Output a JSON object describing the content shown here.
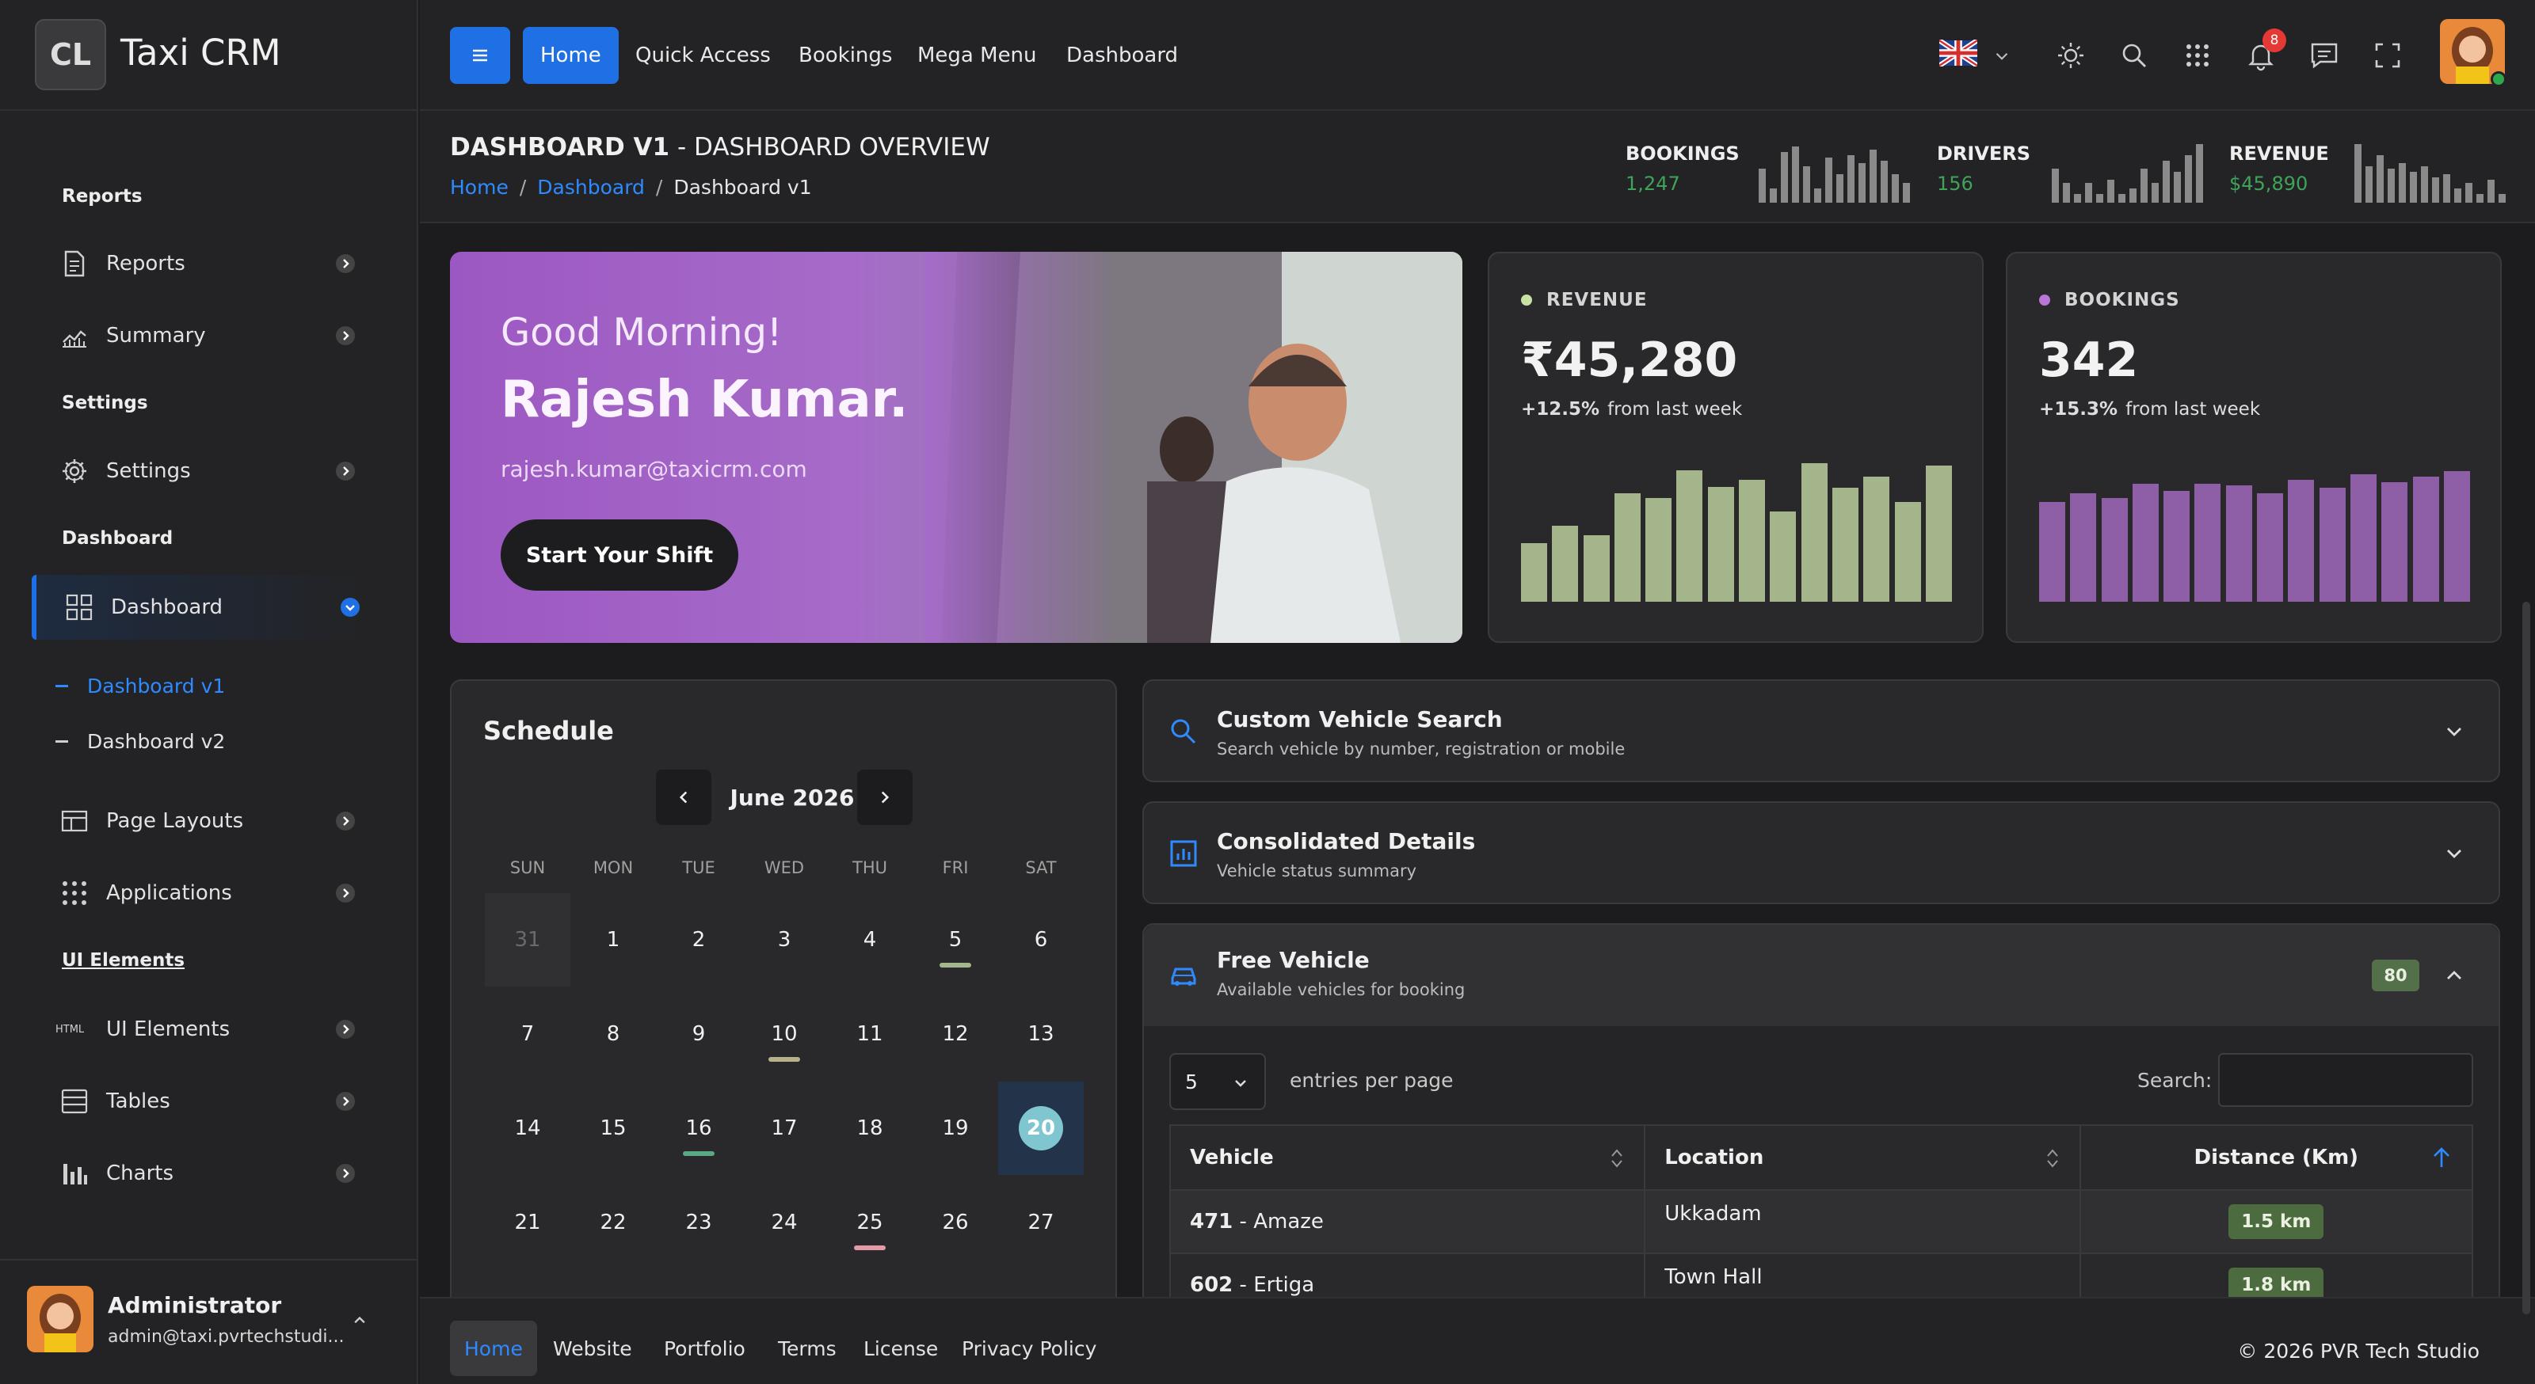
{
  "app": {
    "logo_text": "CL",
    "name": "Taxi CRM"
  },
  "sidebar": {
    "sections": [
      "Reports",
      "Settings",
      "Dashboard",
      "UI Elements"
    ],
    "items": [
      {
        "label": "Reports",
        "icon": "document-icon"
      },
      {
        "label": "Summary",
        "icon": "line-chart-icon"
      },
      {
        "label": "Settings",
        "icon": "gear-icon"
      },
      {
        "label": "Dashboard",
        "icon": "grid-icon",
        "active": true
      },
      {
        "label": "Page Layouts",
        "icon": "layout-icon"
      },
      {
        "label": "Applications",
        "icon": "dots-grid-icon"
      },
      {
        "label": "UI Elements",
        "icon": "html-icon",
        "icon_text": "HTML"
      },
      {
        "label": "Tables",
        "icon": "table-icon"
      },
      {
        "label": "Charts",
        "icon": "bar-chart-icon"
      }
    ],
    "sub_items": [
      {
        "label": "Dashboard v1",
        "active": true
      },
      {
        "label": "Dashboard v2"
      }
    ],
    "user": {
      "name": "Administrator",
      "email": "admin@taxi.pvrtechstudi..."
    }
  },
  "topbar": {
    "nav": [
      "Home",
      "Quick Access",
      "Bookings",
      "Mega Menu",
      "Dashboard"
    ],
    "notification_count": "8"
  },
  "page_header": {
    "title_bold": "DASHBOARD V1",
    "title_rest": " - DASHBOARD OVERVIEW",
    "breadcrumb": [
      "Home",
      "Dashboard",
      "Dashboard v1"
    ],
    "mini_stats": [
      {
        "label": "BOOKINGS",
        "value": "1,247",
        "spark": [
          0.55,
          0.2,
          0.85,
          0.95,
          0.6,
          0.2,
          0.75,
          0.45,
          0.8,
          0.65,
          0.9,
          0.7,
          0.45,
          0.3
        ]
      },
      {
        "label": "DRIVERS",
        "value": "156",
        "spark": [
          0.55,
          0.3,
          0.1,
          0.3,
          0.1,
          0.35,
          0.1,
          0.2,
          0.55,
          0.3,
          0.7,
          0.5,
          0.8,
          1.0
        ]
      },
      {
        "label": "REVENUE",
        "value": "$45,890",
        "spark": [
          1.0,
          0.6,
          0.8,
          0.55,
          0.65,
          0.5,
          0.6,
          0.4,
          0.45,
          0.2,
          0.3,
          0.1,
          0.35,
          0.1
        ]
      }
    ]
  },
  "hero": {
    "greeting": "Good Morning!",
    "name": "Rajesh Kumar.",
    "email": "rajesh.kumar@taxicrm.com",
    "button": "Start Your Shift"
  },
  "stat_cards": [
    {
      "label": "REVENUE",
      "value": "₹45,280",
      "change": "+12.5%",
      "change_text": "from last week",
      "dot_color": "#c6e3a3",
      "bar_color": "#a5b58b",
      "bars": [
        0.42,
        0.55,
        0.48,
        0.78,
        0.75,
        0.95,
        0.83,
        0.88,
        0.65,
        1.0,
        0.82,
        0.9,
        0.72,
        0.98
      ]
    },
    {
      "label": "BOOKINGS",
      "value": "342",
      "change": "+15.3%",
      "change_text": "from last week",
      "dot_color": "#b877d6",
      "bar_color": "#8e5fa6",
      "bars": [
        0.72,
        0.78,
        0.75,
        0.85,
        0.8,
        0.85,
        0.84,
        0.78,
        0.88,
        0.82,
        0.92,
        0.86,
        0.9,
        0.94
      ]
    }
  ],
  "schedule": {
    "title": "Schedule",
    "month": "June 2026",
    "dow": [
      "SUN",
      "MON",
      "TUE",
      "WED",
      "THU",
      "FRI",
      "SAT"
    ],
    "weeks": [
      [
        "31",
        "1",
        "2",
        "3",
        "4",
        "5",
        "6"
      ],
      [
        "7",
        "8",
        "9",
        "10",
        "11",
        "12",
        "13"
      ],
      [
        "14",
        "15",
        "16",
        "17",
        "18",
        "19",
        "20"
      ],
      [
        "21",
        "22",
        "23",
        "24",
        "25",
        "26",
        "27"
      ]
    ],
    "muted": [
      "31"
    ],
    "today": "20",
    "marks": {
      "5": "#a5b58b",
      "10": "#b7b08a",
      "16": "#5aa884",
      "25": "#e19aa6"
    }
  },
  "accordions": [
    {
      "title": "Custom Vehicle Search",
      "subtitle": "Search vehicle by number, registration or mobile",
      "icon": "search-icon"
    },
    {
      "title": "Consolidated Details",
      "subtitle": "Vehicle status summary",
      "icon": "report-chart-icon"
    },
    {
      "title": "Free Vehicle",
      "subtitle": "Available vehicles for booking",
      "icon": "car-icon",
      "badge": "80"
    }
  ],
  "vehicle_table": {
    "entries_value": "5",
    "entries_label": "entries per page",
    "search_label": "Search:",
    "columns": [
      "Vehicle",
      "Location",
      "Distance (Km)"
    ],
    "rows": [
      {
        "number": "471",
        "model": "Amaze",
        "location": "Ukkadam",
        "distance": "1.5 km"
      },
      {
        "number": "602",
        "model": "Ertiga",
        "location": "Town Hall",
        "distance": "1.8 km"
      }
    ]
  },
  "footer": {
    "links": [
      "Home",
      "Website",
      "Portfolio",
      "Terms",
      "License",
      "Privacy Policy"
    ],
    "copyright": "© 2026  PVR Tech Studio"
  },
  "colors": {
    "accent": "#1f6fe5",
    "positive": "#3fa35a"
  }
}
